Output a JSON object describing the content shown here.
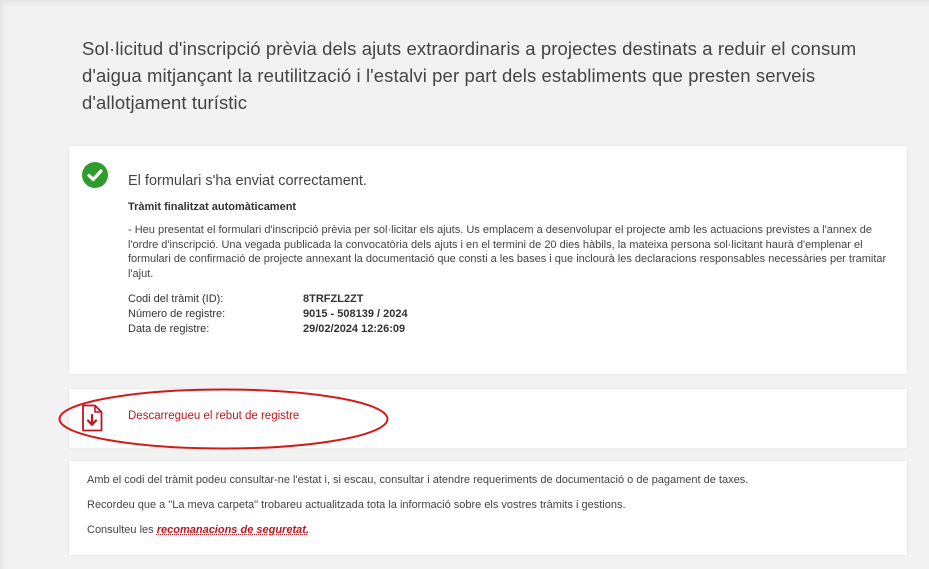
{
  "page": {
    "title": "Sol·licitud d'inscripció prèvia dels ajuts extraordinaris a projectes destinats a reduir el consum d'aigua mitjançant la reutilització i l'estalvi per part dels establiments que presten serveis d'allotjament turístic"
  },
  "success": {
    "icon": "check-circle-icon",
    "heading": "El formulari s'ha enviat correctament.",
    "subheading": "Tràmit finalitzat automàticament",
    "description": "- Heu presentat el formulari d'inscripció prèvia per sol·licitar els ajuts. Us emplacem a desenvolupar el projecte amb les actuacions previstes a l'annex de l'ordre d'inscripció. Una vegada publicada la convocatòria dels ajuts i en el termini de 20 dies hàbils, la mateixa persona sol·licitant haurà d'emplenar el formulari de confirmació de projecte annexant la documentació que consti a les bases i que inclourà les declaracions responsables necessàries per tramitar l'ajut.",
    "meta": [
      {
        "label": "Codi del tràmit (ID):",
        "value": "8TRFZL2ZT"
      },
      {
        "label": "Número de registre:",
        "value": "9015 - 508139 / 2024"
      },
      {
        "label": "Data de registre:",
        "value": "29/02/2024 12:26:09"
      }
    ],
    "accent_color": "#2e9d2e"
  },
  "download": {
    "icon": "pdf-download-icon",
    "label": "Descarregueu el rebut de registre",
    "link_color": "#c0161f",
    "highlight_color": "#d21a1a"
  },
  "info": {
    "line1": "Amb el codi del tràmit podeu consultar-ne l'estat i, si escau, consultar i atendre requeriments de documentació o de pagament de taxes.",
    "line2": "Recordeu que a \"La meva carpeta\" trobareu actualitzada tota la informació sobre els vostres tràmits i gestions.",
    "line3_prefix": "Consulteu les ",
    "line3_link": "recomanacions de seguretat."
  }
}
